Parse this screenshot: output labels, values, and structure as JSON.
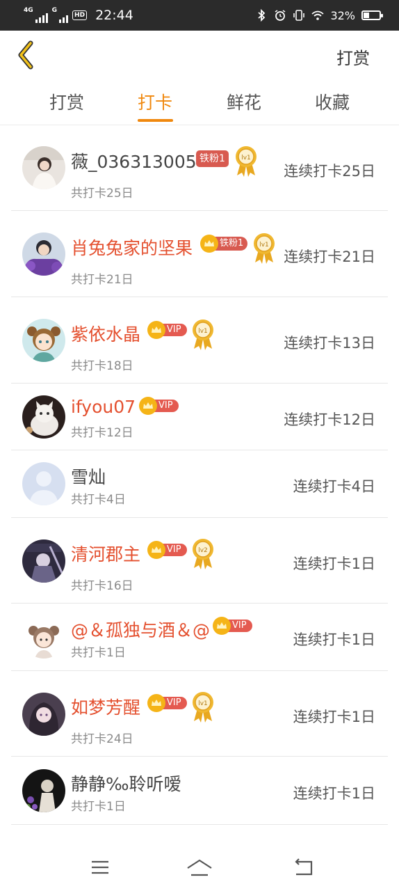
{
  "status_bar": {
    "net1": "4G",
    "net2": "G",
    "hd": "HD",
    "time": "22:44",
    "battery": "32%",
    "battery_level": 0.32
  },
  "header": {
    "back_icon": "chevron-left-icon",
    "action_label": "打赏"
  },
  "tabs": [
    {
      "label": "打赏",
      "active": false
    },
    {
      "label": "打卡",
      "active": true
    },
    {
      "label": "鲜花",
      "active": false
    },
    {
      "label": "收藏",
      "active": false
    }
  ],
  "colors": {
    "accent": "#f0880e",
    "vip_name": "#e4502f",
    "badge_red": "#d85a50",
    "crown_gold": "#f5b417"
  },
  "list": [
    {
      "name": "薇_036313005",
      "total": "共打卡25日",
      "streak": "连续打卡25日",
      "vip": false,
      "badge": "铁粉1",
      "medal": "lv1"
    },
    {
      "name": "肖兔兔家的坚果",
      "total": "共打卡21日",
      "streak": "连续打卡21日",
      "vip": true,
      "badge": "铁粉1",
      "medal": "lv1"
    },
    {
      "name": "紫依水晶",
      "total": "共打卡18日",
      "streak": "连续打卡13日",
      "vip": true,
      "badge": "VIP",
      "medal": "lv1"
    },
    {
      "name": "ifyou07",
      "total": "共打卡12日",
      "streak": "连续打卡12日",
      "vip": true,
      "badge": "VIP",
      "medal": ""
    },
    {
      "name": "雪灿",
      "total": "共打卡4日",
      "streak": "连续打卡4日",
      "vip": false,
      "badge": "",
      "medal": ""
    },
    {
      "name": "清河郡主",
      "total": "共打卡16日",
      "streak": "连续打卡1日",
      "vip": true,
      "badge": "VIP",
      "medal": "lv2"
    },
    {
      "name": "@＆孤独与酒＆@",
      "total": "共打卡1日",
      "streak": "连续打卡1日",
      "vip": true,
      "badge": "VIP",
      "medal": ""
    },
    {
      "name": "如梦芳醒",
      "total": "共打卡24日",
      "streak": "连续打卡1日",
      "vip": true,
      "badge": "VIP",
      "medal": "lv1"
    },
    {
      "name": "静静‰聆听嗳",
      "total": "共打卡1日",
      "streak": "连续打卡1日",
      "vip": false,
      "badge": "",
      "medal": ""
    }
  ],
  "navbar": {
    "menu_icon": "menu-icon",
    "home_icon": "home-icon",
    "back_icon": "back-icon"
  }
}
